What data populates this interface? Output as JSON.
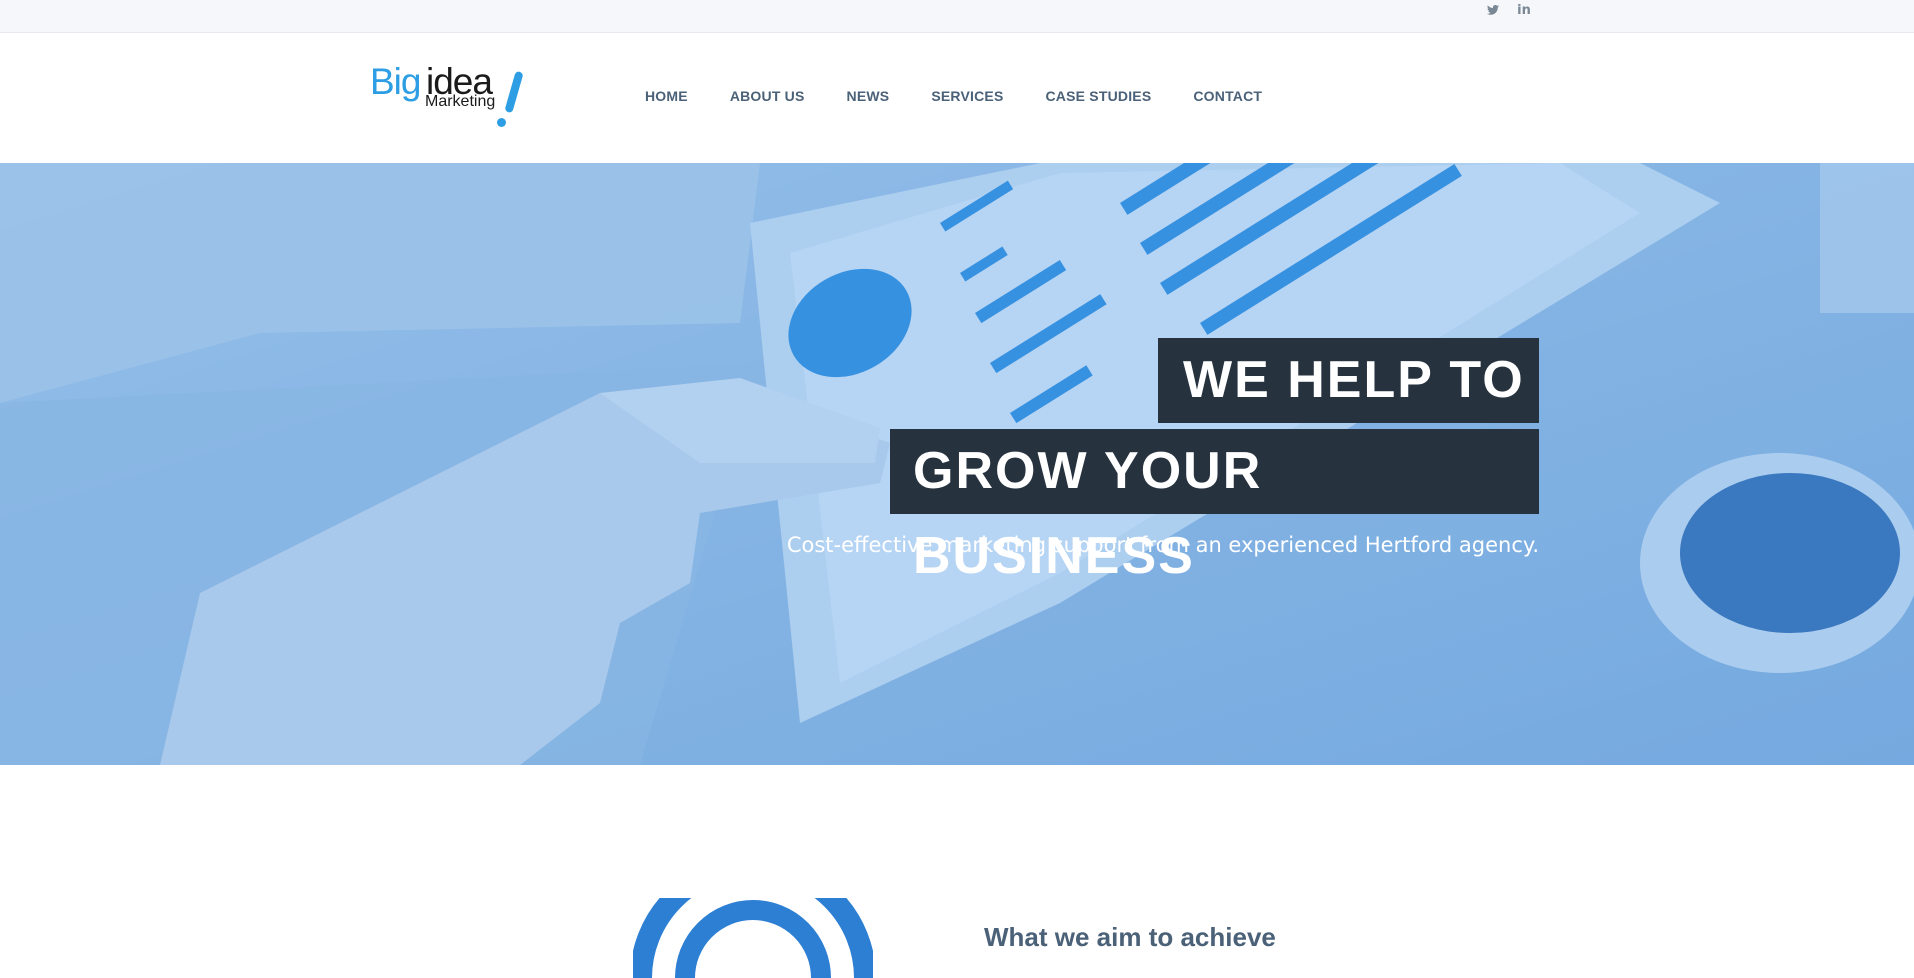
{
  "topbar": {
    "social": [
      {
        "name": "twitter-icon",
        "glyph": "🐦"
      },
      {
        "name": "linkedin-icon",
        "glyph": "in"
      }
    ]
  },
  "header": {
    "logo": {
      "big": "Big",
      "idea": "idea",
      "sub": "Marketing"
    },
    "nav": [
      "HOME",
      "ABOUT US",
      "NEWS",
      "SERVICES",
      "CASE STUDIES",
      "CONTACT"
    ]
  },
  "hero": {
    "headline_line1": "WE HELP TO",
    "headline_line2": "GROW YOUR BUSINESS",
    "subline": "Cost-effective marketing support from an experienced Hertford agency."
  },
  "section": {
    "title": "What we aim to achieve"
  },
  "colors": {
    "accent": "#2d9ee3",
    "nav_text": "#4a6178",
    "headline_bg": "#27323f"
  }
}
